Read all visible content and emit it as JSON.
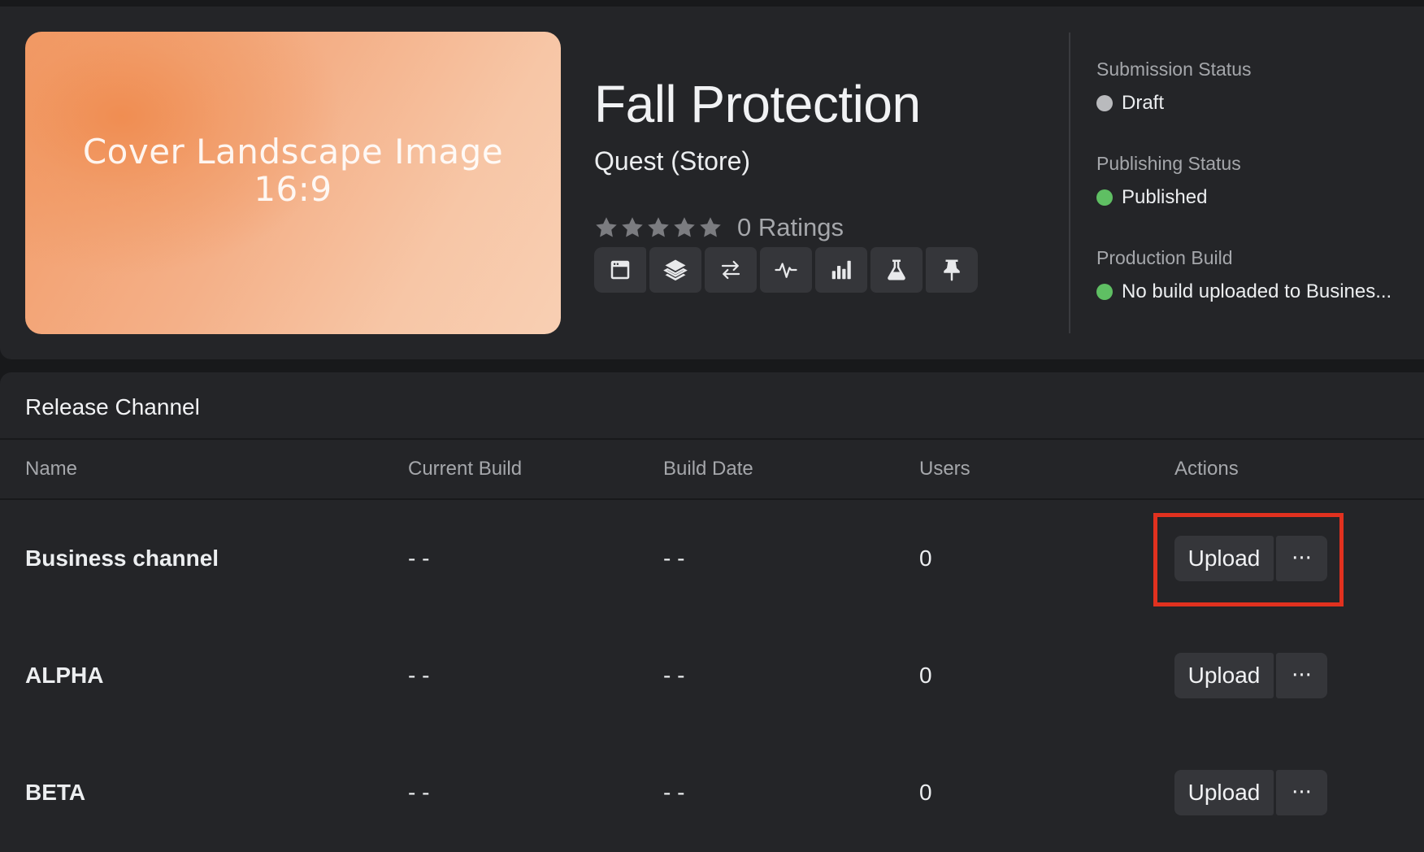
{
  "cover": {
    "title": "Cover Landscape Image",
    "ratio": "16:9"
  },
  "app": {
    "title": "Fall Protection",
    "platform": "Quest (Store)",
    "rating_stars": 0,
    "ratings_text": "0 Ratings"
  },
  "toolbar": {
    "icons": [
      "window-icon",
      "layers-icon",
      "swap-arrows-icon",
      "pulse-icon",
      "bar-chart-icon",
      "flask-icon",
      "pin-icon"
    ]
  },
  "status": {
    "submission": {
      "label": "Submission Status",
      "value": "Draft",
      "color": "#b9babd"
    },
    "publishing": {
      "label": "Publishing Status",
      "value": "Published",
      "color": "#5fbf63"
    },
    "production": {
      "label": "Production Build",
      "value": "No build uploaded to Busines...",
      "color": "#5fbf63"
    }
  },
  "release_channel": {
    "title": "Release Channel",
    "columns": [
      "Name",
      "Current Build",
      "Build Date",
      "Users",
      "Actions"
    ],
    "rows": [
      {
        "name": "Business channel",
        "current_build": "- -",
        "build_date": "- -",
        "users": "0",
        "upload_label": "Upload",
        "more_label": "···"
      },
      {
        "name": "ALPHA",
        "current_build": "- -",
        "build_date": "- -",
        "users": "0",
        "upload_label": "Upload",
        "more_label": "···"
      },
      {
        "name": "BETA",
        "current_build": "- -",
        "build_date": "- -",
        "users": "0",
        "upload_label": "Upload",
        "more_label": "···"
      }
    ]
  },
  "highlight_color": "#e1311f"
}
